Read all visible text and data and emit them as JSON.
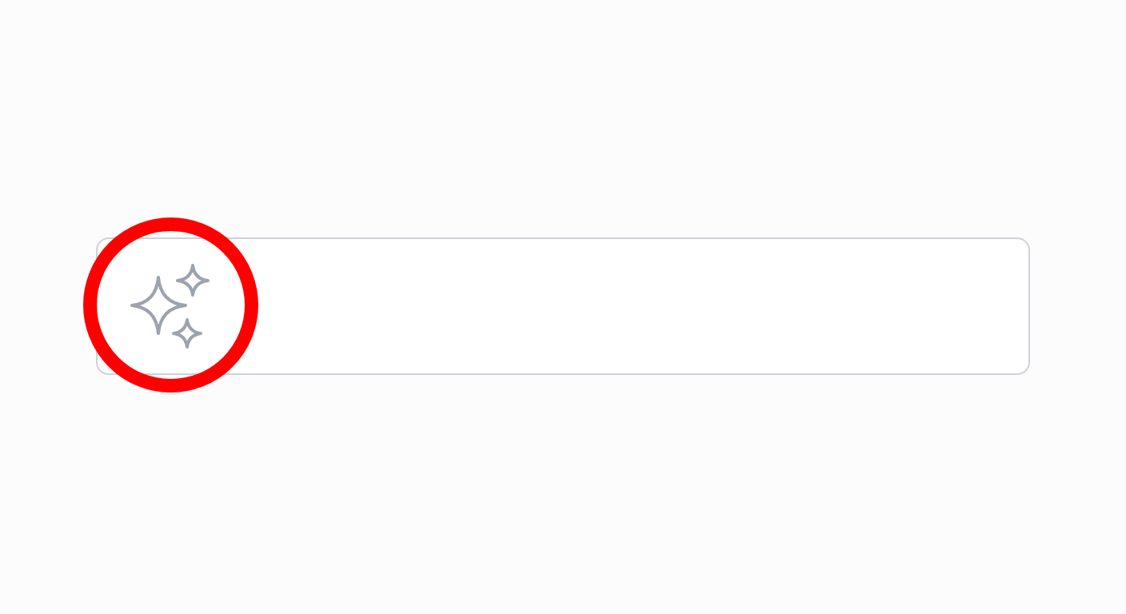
{
  "prompt_field": {
    "kind": "sparkles"
  },
  "highlight": {
    "kind": "circle"
  }
}
